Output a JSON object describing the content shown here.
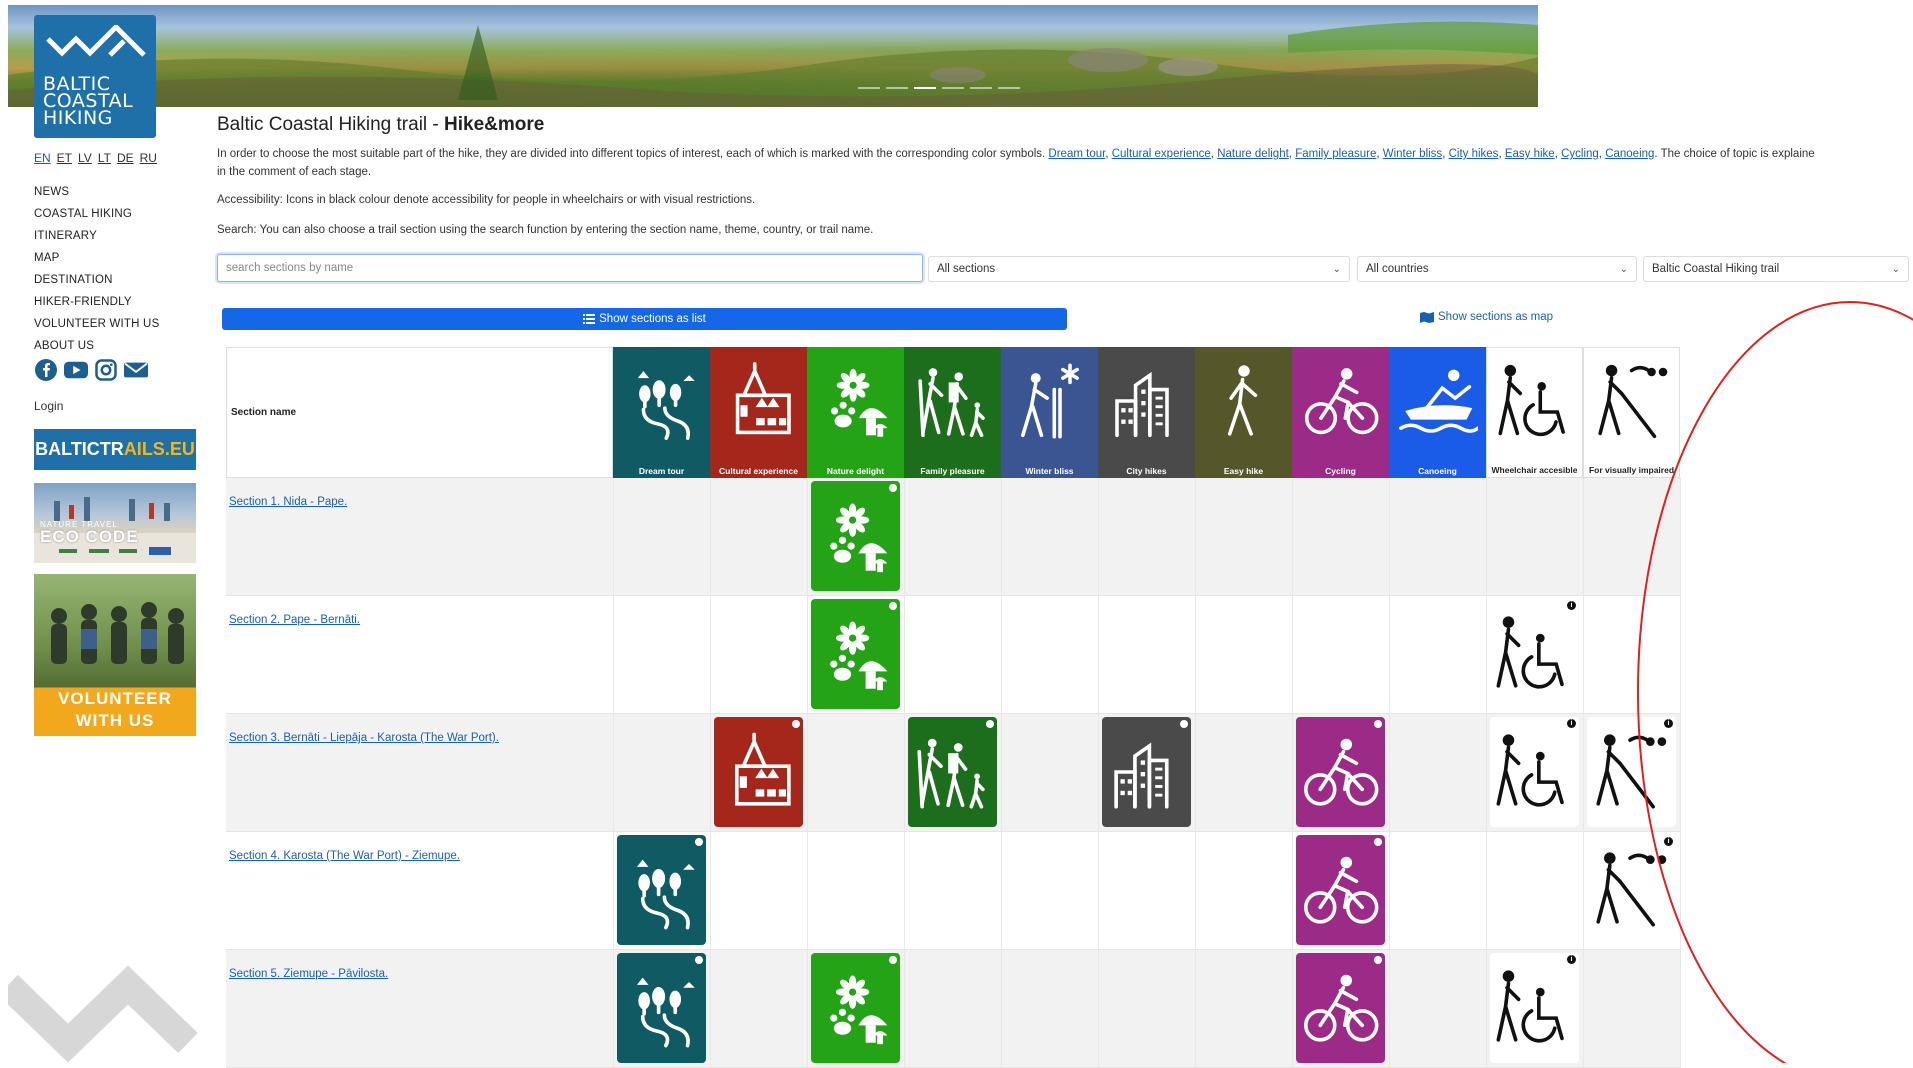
{
  "logo": {
    "lines": [
      "BALTIC",
      "COASTAL",
      "HIKING"
    ]
  },
  "languages": [
    "EN",
    "ET",
    "LV",
    "LT",
    "DE",
    "RU"
  ],
  "nav": [
    "NEWS",
    "COASTAL HIKING",
    "ITINERARY",
    "MAP",
    "DESTINATION",
    "HIKER-FRIENDLY",
    "VOLUNTEER WITH US",
    "ABOUT US"
  ],
  "social_icons": [
    "facebook-icon",
    "youtube-icon",
    "instagram-icon",
    "mail-icon"
  ],
  "login": "Login",
  "baltictrails": {
    "part1": "BALTICTR",
    "part2": "AILS.EU"
  },
  "eco_banner": {
    "small": "NATURE TRAVEL",
    "label": "ECO CODE"
  },
  "volunteer_banner": {
    "line1": "VOLUNTEER",
    "line2": "WITH US"
  },
  "page_title": {
    "prefix": "Baltic Coastal Hiking trail - ",
    "bold": "Hike&more"
  },
  "intro": {
    "lead": "In order to choose the most suitable part of the hike, they are divided into different topics of interest, each of which is marked with the corresponding color symbols. ",
    "links": [
      "Dream tour",
      "Cultural experience",
      "Nature delight",
      "Family pleasure",
      "Winter bliss",
      "City hikes",
      "Easy hike",
      "Cycling",
      "Canoeing"
    ],
    "tail": ". The choice of topic is explaine",
    "line2": "in the comment of each stage."
  },
  "accessibility_text": "Accessibility: Icons in black colour denote accessibility for people in wheelchairs or with visual restrictions.",
  "search_text": "Search: You can also choose a trail section using the search function by entering the section name, theme, country, or trail name.",
  "search": {
    "placeholder": "search sections by name"
  },
  "filters": {
    "sections": "All sections",
    "countries": "All countries",
    "trail": "Baltic Coastal Hiking trail"
  },
  "buttons": {
    "list": "Show sections as list",
    "map": "Show sections as map"
  },
  "table": {
    "name_header": "Section name",
    "columns": [
      {
        "key": "dream",
        "label": "Dream tour",
        "color": "#0f5a63"
      },
      {
        "key": "culture",
        "label": "Cultural experience",
        "color": "#a5271c"
      },
      {
        "key": "nature",
        "label": "Nature delight",
        "color": "#24a317"
      },
      {
        "key": "family",
        "label": "Family pleasure",
        "color": "#1c6e1c"
      },
      {
        "key": "winter",
        "label": "Winter bliss",
        "color": "#3b5492"
      },
      {
        "key": "city",
        "label": "City hikes",
        "color": "#4a4a4a"
      },
      {
        "key": "easy",
        "label": "Easy hike",
        "color": "#55562a"
      },
      {
        "key": "cycling",
        "label": "Cycling",
        "color": "#9c2a87"
      },
      {
        "key": "canoe",
        "label": "Canoeing",
        "color": "#1a5ce8"
      },
      {
        "key": "wheelchair",
        "label": "Wheelchair accesible",
        "color": "#ffffff"
      },
      {
        "key": "visual",
        "label": "For visually impaired",
        "color": "#ffffff"
      }
    ],
    "rows": [
      {
        "name": "Section 1. Nida - Pape.",
        "marks": [
          "nature"
        ]
      },
      {
        "name": "Section 2. Pape - Bernāti.",
        "marks": [
          "nature",
          "wheelchair"
        ]
      },
      {
        "name": "Section 3. Bernāti - Liepāja - Karosta (The War Port).",
        "marks": [
          "culture",
          "family",
          "city",
          "cycling",
          "wheelchair",
          "visual"
        ]
      },
      {
        "name": "Section 4. Karosta (The War Port) - Ziemupe.",
        "marks": [
          "dream",
          "cycling",
          "visual"
        ]
      },
      {
        "name": "Section 5. Ziemupe - Pāvilosta.",
        "marks": [
          "dream",
          "nature",
          "cycling",
          "wheelchair"
        ]
      }
    ]
  }
}
